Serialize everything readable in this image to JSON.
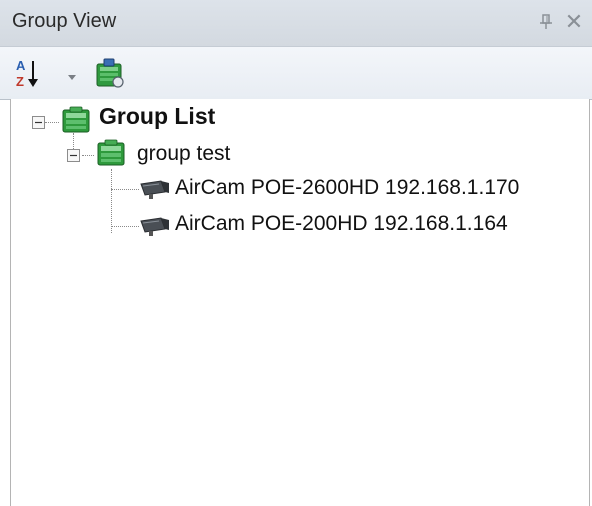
{
  "panel": {
    "title": "Group View",
    "pin_glyph": "ᵽ",
    "close_glyph": "✕"
  },
  "toolbar": {
    "sort_icon": "sort-az-icon",
    "dropdown_icon": "dropdown-arrow-icon",
    "refresh_icon": "group-settings-icon"
  },
  "tree": {
    "root": {
      "label": "Group List",
      "icon": "group-folder-icon",
      "expanded": true,
      "children": [
        {
          "label": "group test",
          "icon": "group-folder-icon",
          "expanded": true,
          "children": [
            {
              "label": "AirCam POE-2600HD 192.168.1.170",
              "icon": "camera-icon"
            },
            {
              "label": "AirCam POE-200HD 192.168.1.164",
              "icon": "camera-icon"
            }
          ]
        }
      ]
    }
  },
  "colors": {
    "titlebar": "#d8dee5",
    "toolbar": "#eef2f7",
    "folder_green": "#2e9a3c",
    "text": "#111111"
  }
}
